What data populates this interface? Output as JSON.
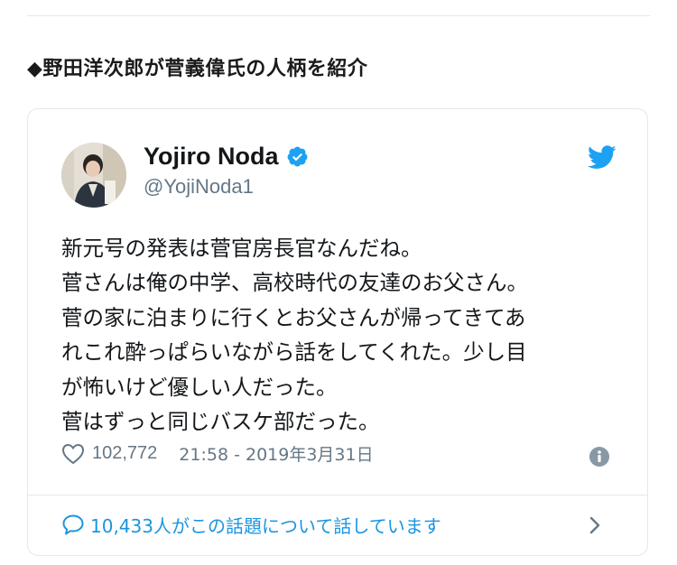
{
  "section": {
    "heading": "◆野田洋次郎が菅義偉氏の人柄を紹介"
  },
  "tweet": {
    "display_name": "Yojiro Noda",
    "handle": "@YojiNoda1",
    "verified": true,
    "text_lines": [
      "新元号の発表は菅官房長官なんだね。",
      "菅さんは俺の中学、高校時代の友達のお父さん。",
      "菅の家に泊まりに行くとお父さんが帰ってきてあ",
      "れこれ酔っぱらいながら話をしてくれた。少し目",
      "が怖いけど優しい人だった。",
      "菅はずっと同じバスケ部だった。"
    ],
    "like_count": "102,772",
    "timestamp": "21:58 - 2019年3月31日",
    "conversation_text": "10,433人がこの話題について話しています"
  },
  "icons": {
    "verified": "verified-badge-icon",
    "twitter": "twitter-bird-icon",
    "heart": "heart-icon",
    "info": "info-icon",
    "comment": "comment-icon",
    "chevron": "chevron-right-icon"
  },
  "colors": {
    "twitter_blue": "#1da1f2",
    "link_blue": "#1b95e0",
    "secondary_text": "#657786",
    "border": "#e1e8ed"
  }
}
